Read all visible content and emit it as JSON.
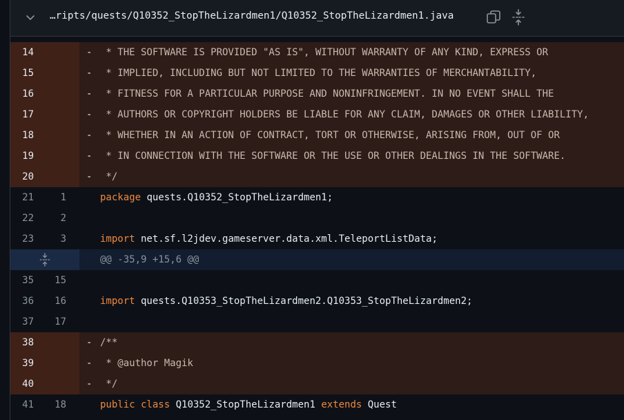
{
  "file": {
    "path": "…ripts/quests/Q10352_StopTheLizardmen1/Q10352_StopTheLizardmen1.java",
    "icons": {
      "collapse": "chevron-down-icon",
      "copy": "copy-icon",
      "expand": "unfold-icon"
    }
  },
  "hunk": {
    "header": "@@ -35,9 +15,6 @@",
    "icon": "unfold-icon"
  },
  "lines": [
    {
      "type": "del",
      "old": "14",
      "new": "",
      "marker": "-",
      "text": " * THE SOFTWARE IS PROVIDED \"AS IS\", WITHOUT WARRANTY OF ANY KIND, EXPRESS OR"
    },
    {
      "type": "del",
      "old": "15",
      "new": "",
      "marker": "-",
      "text": " * IMPLIED, INCLUDING BUT NOT LIMITED TO THE WARRANTIES OF MERCHANTABILITY,"
    },
    {
      "type": "del",
      "old": "16",
      "new": "",
      "marker": "-",
      "text": " * FITNESS FOR A PARTICULAR PURPOSE AND NONINFRINGEMENT. IN NO EVENT SHALL THE"
    },
    {
      "type": "del",
      "old": "17",
      "new": "",
      "marker": "-",
      "text": " * AUTHORS OR COPYRIGHT HOLDERS BE LIABLE FOR ANY CLAIM, DAMAGES OR OTHER LIABILITY,"
    },
    {
      "type": "del",
      "old": "18",
      "new": "",
      "marker": "-",
      "text": " * WHETHER IN AN ACTION OF CONTRACT, TORT OR OTHERWISE, ARISING FROM, OUT OF OR"
    },
    {
      "type": "del",
      "old": "19",
      "new": "",
      "marker": "-",
      "text": " * IN CONNECTION WITH THE SOFTWARE OR THE USE OR OTHER DEALINGS IN THE SOFTWARE."
    },
    {
      "type": "del",
      "old": "20",
      "new": "",
      "marker": "-",
      "text": " */"
    },
    {
      "type": "ctx",
      "old": "21",
      "new": "1",
      "kw": "package",
      "text": " quests.Q10352_StopTheLizardmen1;"
    },
    {
      "type": "ctx",
      "old": "22",
      "new": "2",
      "kw": "",
      "text": ""
    },
    {
      "type": "ctx",
      "old": "23",
      "new": "3",
      "kw": "import",
      "text": " net.sf.l2jdev.gameserver.data.xml.TeleportListData;"
    },
    {
      "type": "hunk"
    },
    {
      "type": "ctx",
      "old": "35",
      "new": "15",
      "kw": "",
      "text": ""
    },
    {
      "type": "ctx",
      "old": "36",
      "new": "16",
      "kw": "import",
      "text": " quests.Q10353_StopTheLizardmen2.Q10353_StopTheLizardmen2;"
    },
    {
      "type": "ctx",
      "old": "37",
      "new": "17",
      "kw": "",
      "text": ""
    },
    {
      "type": "del",
      "old": "38",
      "new": "",
      "marker": "-",
      "text": "/**"
    },
    {
      "type": "del",
      "old": "39",
      "new": "",
      "marker": "-",
      "text": " * @author Magik"
    },
    {
      "type": "del",
      "old": "40",
      "new": "",
      "marker": "-",
      "text": " */"
    },
    {
      "type": "ctx",
      "old": "41",
      "new": "18",
      "kw": "public class",
      "text": " Q10352_StopTheLizardmen1 ",
      "kw2": "extends",
      "tail": " Quest"
    }
  ]
}
